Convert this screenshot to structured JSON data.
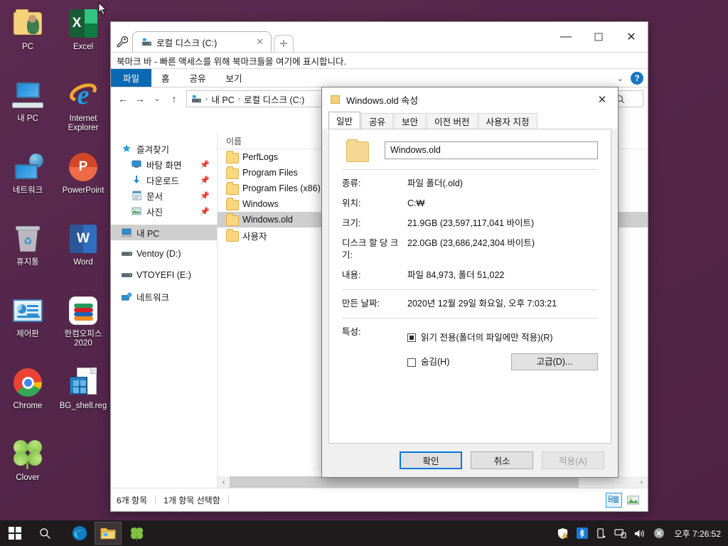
{
  "desktop": {
    "background_color": "#56264c",
    "icons": [
      {
        "label": "PC",
        "icon": "folder-user-icon"
      },
      {
        "label": "Excel",
        "icon": "excel-icon"
      },
      {
        "label": "내 PC",
        "icon": "this-pc-icon"
      },
      {
        "label": "Internet Explorer",
        "icon": "internet-explorer-icon"
      },
      {
        "label": "네트워크",
        "icon": "network-icon"
      },
      {
        "label": "PowerPoint",
        "icon": "powerpoint-icon"
      },
      {
        "label": "휴지통",
        "icon": "recycle-bin-icon"
      },
      {
        "label": "Word",
        "icon": "word-icon"
      },
      {
        "label": "제어판",
        "icon": "control-panel-icon"
      },
      {
        "label": "한컴오피스 2020",
        "icon": "hancom-office-icon"
      },
      {
        "label": "Chrome",
        "icon": "chrome-icon"
      },
      {
        "label": "BG_shell.reg",
        "icon": "registry-file-icon"
      },
      {
        "label": "Clover",
        "icon": "clover-icon"
      }
    ]
  },
  "explorer": {
    "tab": {
      "label": "로컬 디스크 (C:)",
      "close": "✕",
      "new_tab": "✛"
    },
    "window_controls": {
      "minimize": "—",
      "maximize": "☐",
      "close": "✕"
    },
    "bookmark_bar": "북마크 바 - 빠른 액세스를 위해 북마크들을 여기에 표시합니다.",
    "ribbon_tabs": [
      {
        "label": "파일",
        "active": true
      },
      {
        "label": "홈",
        "active": false
      },
      {
        "label": "공유",
        "active": false
      },
      {
        "label": "보기",
        "active": false
      }
    ],
    "ribbon_right": {
      "collapse": "⌄",
      "help": "?"
    },
    "nav": {
      "back": "←",
      "forward": "→",
      "recent": "⌄",
      "up": "↑"
    },
    "breadcrumb": [
      "내 PC",
      "로컬 디스크 (C:)"
    ],
    "breadcrumb_separator": "›",
    "search_placeholder": "",
    "sidebar": [
      {
        "label": "즐겨찾기",
        "icon": "star-icon",
        "level": 1,
        "pinned": false,
        "selected": false
      },
      {
        "label": "바탕 화면",
        "icon": "desktop-icon",
        "level": 2,
        "pinned": true,
        "selected": false
      },
      {
        "label": "다운로드",
        "icon": "download-icon",
        "level": 2,
        "pinned": true,
        "selected": false
      },
      {
        "label": "문서",
        "icon": "documents-icon",
        "level": 2,
        "pinned": true,
        "selected": false
      },
      {
        "label": "사진",
        "icon": "pictures-icon",
        "level": 2,
        "pinned": true,
        "selected": false
      },
      {
        "label": "내 PC",
        "icon": "this-pc-icon",
        "level": 1,
        "pinned": false,
        "selected": true
      },
      {
        "label": "Ventoy (D:)",
        "icon": "drive-icon",
        "level": 1,
        "pinned": false,
        "selected": false
      },
      {
        "label": "VTOYEFI (E:)",
        "icon": "drive-icon",
        "level": 1,
        "pinned": false,
        "selected": false
      },
      {
        "label": "네트워크",
        "icon": "network-icon",
        "level": 1,
        "pinned": false,
        "selected": false
      }
    ],
    "column_header": "이름",
    "files": [
      {
        "name": "PerfLogs",
        "selected": false
      },
      {
        "name": "Program Files",
        "selected": false
      },
      {
        "name": "Program Files (x86)",
        "selected": false
      },
      {
        "name": "Windows",
        "selected": false
      },
      {
        "name": "Windows.old",
        "selected": true
      },
      {
        "name": "사용자",
        "selected": false
      }
    ],
    "status": {
      "item_count": "6개 항목",
      "selection": "1개 항목 선택함"
    },
    "view_buttons": {
      "details": "details-view-icon",
      "large_icons": "large-icons-view-icon"
    },
    "scrollbar": {
      "left_arrow": "‹",
      "right_arrow": "›"
    }
  },
  "dialog": {
    "title": "Windows.old 속성",
    "close": "✕",
    "tabs": [
      {
        "label": "일반",
        "active": true
      },
      {
        "label": "공유",
        "active": false
      },
      {
        "label": "보안",
        "active": false
      },
      {
        "label": "이전 버전",
        "active": false
      },
      {
        "label": "사용자 지정",
        "active": false
      }
    ],
    "name_value": "Windows.old",
    "rows": [
      {
        "label": "종류:",
        "value": "파일 폴더(.old)"
      },
      {
        "label": "위치:",
        "value": "C:₩"
      },
      {
        "label": "크기:",
        "value": "21.9GB (23,597,117,041 바이트)"
      },
      {
        "label": "디스크 할 당 크기:",
        "value": "22.0GB (23,686,242,304 바이트)"
      },
      {
        "label": "내용:",
        "value": "파일 84,973, 폴더 51,022"
      }
    ],
    "created": {
      "label": "만든 날짜:",
      "value": "2020년 12월 29일 화요일, 오후 7:03:21"
    },
    "attributes": {
      "label": "특성:",
      "readonly": {
        "label": "읽기 전용(폴더의 파일에만 적용)(R)",
        "state": "indeterminate"
      },
      "hidden": {
        "label": "숨김(H)",
        "state": "unchecked"
      },
      "advanced_button": "고급(D)..."
    },
    "buttons": {
      "ok": "확인",
      "cancel": "취소",
      "apply": "적용(A)"
    },
    "accent_color": "#0078d7"
  },
  "taskbar": {
    "start": "start-icon",
    "search": "search-icon",
    "apps": [
      {
        "name": "edge-icon",
        "active": false
      },
      {
        "name": "file-explorer-icon",
        "active": true
      },
      {
        "name": "clover-icon",
        "active": false
      }
    ],
    "tray": [
      "defender-warning-icon",
      "bluetooth-icon",
      "usb-eject-icon",
      "network-icon",
      "volume-icon",
      "close-icon"
    ],
    "clock": "오후 7:26:52"
  }
}
